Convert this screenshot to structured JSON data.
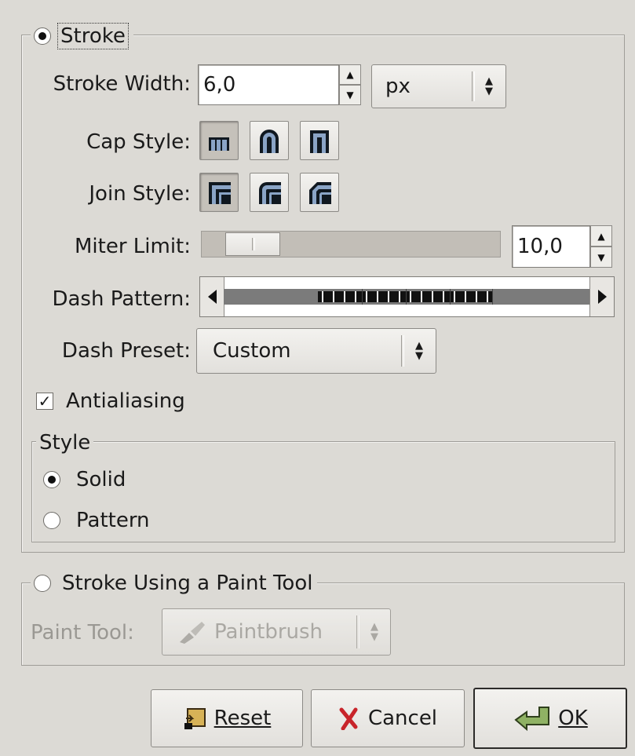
{
  "stroke": {
    "radio_label": "Stroke",
    "selected": true,
    "width": {
      "label": "Stroke Width:",
      "value": "6,0",
      "unit": "px"
    },
    "cap_style": {
      "label": "Cap Style:",
      "options": [
        "butt-cap",
        "round-cap",
        "square-cap"
      ],
      "selected": 0
    },
    "join_style": {
      "label": "Join Style:",
      "options": [
        "miter-join",
        "round-join",
        "bevel-join"
      ],
      "selected": 0
    },
    "miter_limit": {
      "label": "Miter Limit:",
      "value": "10,0"
    },
    "dash_pattern": {
      "label": "Dash Pattern:"
    },
    "dash_preset": {
      "label": "Dash Preset:",
      "value": "Custom"
    },
    "antialiasing": {
      "label": "Antialiasing",
      "checked": true
    },
    "style": {
      "title": "Style",
      "options": [
        {
          "label": "Solid",
          "selected": true
        },
        {
          "label": "Pattern",
          "selected": false
        }
      ]
    }
  },
  "paint_tool": {
    "radio_label": "Stroke Using a Paint Tool",
    "selected": false,
    "tool_label": "Paint Tool:",
    "tool_value": "Paintbrush"
  },
  "buttons": {
    "reset": "Reset",
    "cancel": "Cancel",
    "ok": "OK"
  },
  "colors": {
    "background": "#dcdad5",
    "cap_icon_fill": "#8aa4c6",
    "cancel_x": "#c8242a",
    "ok_icon": "#8fb264"
  }
}
